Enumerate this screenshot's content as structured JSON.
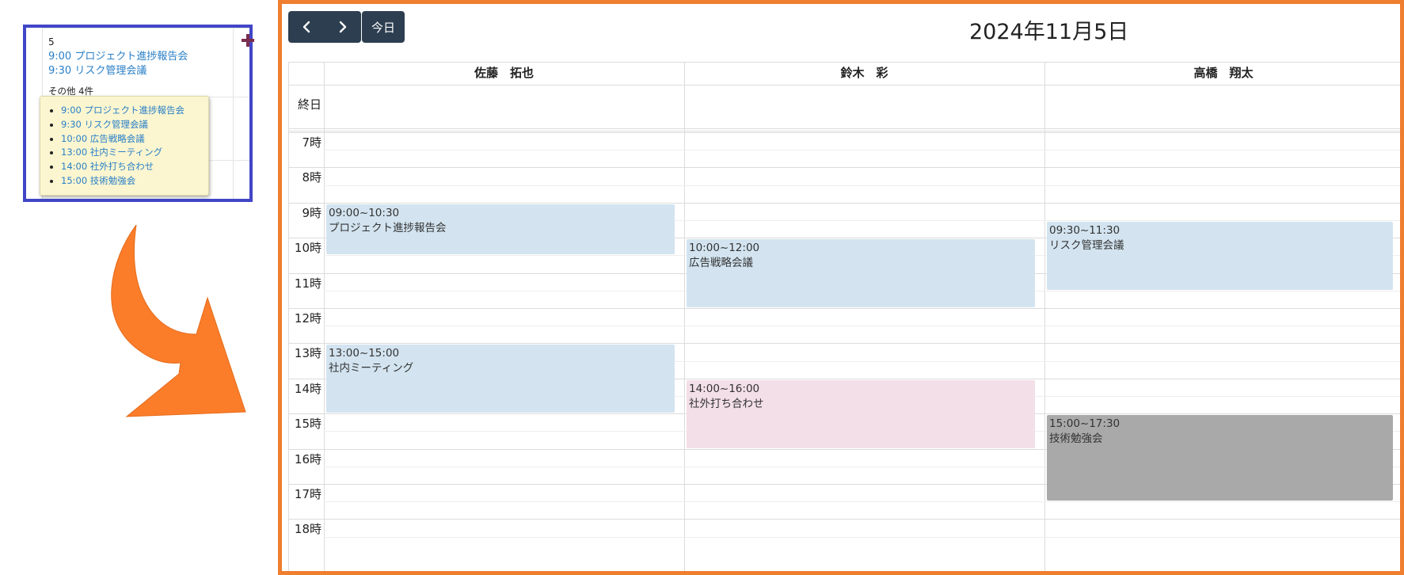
{
  "month_cell": {
    "day_number": "5",
    "add_icon": "plus-icon",
    "events": [
      {
        "label": "9:00 プロジェクト進捗報告会"
      },
      {
        "label": "9:30 リスク管理会議"
      }
    ],
    "more_text": "その他 4件",
    "popup_items": [
      {
        "label": "9:00 プロジェクト進捗報告会"
      },
      {
        "label": "9:30 リスク管理会議"
      },
      {
        "label": "10:00 広告戦略会議"
      },
      {
        "label": "13:00 社内ミーティング"
      },
      {
        "label": "14:00 社外打ち合わせ"
      },
      {
        "label": "15:00 技術勉強会"
      }
    ]
  },
  "arrow_icon": "curved-arrow-icon",
  "calendar": {
    "prev_icon": "chevron-left-icon",
    "next_icon": "chevron-right-icon",
    "today_label": "今日",
    "title": "2024年11月5日",
    "allday_label": "終日",
    "resources": [
      {
        "name": "佐藤　拓也"
      },
      {
        "name": "鈴木　彩"
      },
      {
        "name": "高橋　翔太"
      }
    ],
    "hours": [
      "7時",
      "8時",
      "9時",
      "10時",
      "11時",
      "12時",
      "13時",
      "14時",
      "15時",
      "16時",
      "17時",
      "18時"
    ],
    "events": [
      {
        "resource": 0,
        "start": 9.0,
        "end": 10.5,
        "time": "09:00~10:30",
        "title": "プロジェクト進捗報告会",
        "color": "blue"
      },
      {
        "resource": 1,
        "start": 10.0,
        "end": 12.0,
        "time": "10:00~12:00",
        "title": "広告戦略会議",
        "color": "blue"
      },
      {
        "resource": 2,
        "start": 9.5,
        "end": 11.5,
        "time": "09:30~11:30",
        "title": "リスク管理会議",
        "color": "blue"
      },
      {
        "resource": 0,
        "start": 13.0,
        "end": 15.0,
        "time": "13:00~15:00",
        "title": "社内ミーティング",
        "color": "blue"
      },
      {
        "resource": 1,
        "start": 14.0,
        "end": 16.0,
        "time": "14:00~16:00",
        "title": "社外打ち合わせ",
        "color": "pink"
      },
      {
        "resource": 2,
        "start": 15.0,
        "end": 17.5,
        "time": "15:00~17:30",
        "title": "技術勉強会",
        "color": "gray"
      }
    ],
    "colors": {
      "blue": "#d3e4f0",
      "pink": "#f3dfe8",
      "gray": "#a9a9a9",
      "nav": "#2c3e50",
      "frame": "#ef7e2f"
    }
  }
}
